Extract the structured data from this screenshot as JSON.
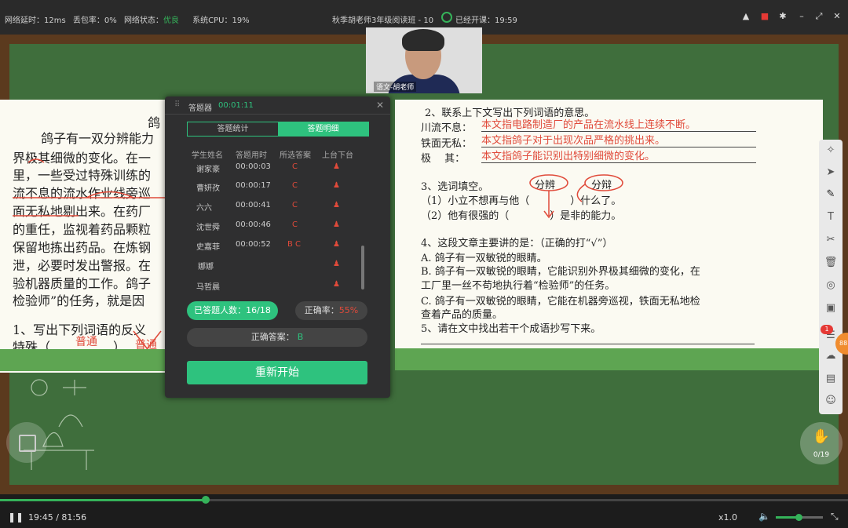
{
  "topbar": {
    "latency": "网络延时：12ms",
    "packet_loss": "丢包率：0%",
    "net_state_label": "网络状态：",
    "net_state_value": "优良",
    "cpu": "系统CPU：19%",
    "class_title": "秋季胡老师3年级阅读班 - 10",
    "elapsed": "已经开课：19:59"
  },
  "video": {
    "teacher_label": "语文-胡老师"
  },
  "left_page": {
    "heading": "鸽",
    "lines": [
      "鸽子有一双分辨能力",
      "界极其细微的变化。在一",
      "里，一些受过特殊训练的",
      "流不息的流水作业线旁巡",
      "面无私地剔出来。在药厂",
      "的重任，监视着药品颗粒",
      "保留地拣出药品。在炼钢",
      "泄，必要时发出警报。在",
      "验机器质量的工作。鸽子",
      "检验师”的任务，就是因"
    ],
    "q1": "1、写出下列词语的反义",
    "q1_line": "特殊（",
    "q1_close": "）",
    "q1_answer": "普通",
    "q1_crossed": "普通"
  },
  "quiz": {
    "title": "答题器",
    "timer": "00:01:11",
    "tabs": [
      "答题统计",
      "答题明细"
    ],
    "columns": [
      "学生姓名",
      "答题用时",
      "所选答案",
      "上台下台"
    ],
    "rows": [
      {
        "name": "谢家豪",
        "time": "00:00:03",
        "answer": "C"
      },
      {
        "name": "曹妍孜",
        "time": "00:00:17",
        "answer": "C"
      },
      {
        "name": "六六",
        "time": "00:00:41",
        "answer": "C"
      },
      {
        "name": "沈世舜",
        "time": "00:00:46",
        "answer": "C"
      },
      {
        "name": "史嘉菲",
        "time": "00:00:52",
        "answer": "B C"
      },
      {
        "name": "娜娜",
        "time": "",
        "answer": ""
      },
      {
        "name": "马哲晨",
        "time": "",
        "answer": ""
      }
    ],
    "answered": "已答题人数：16/18",
    "accuracy_label": "正确率：",
    "accuracy_value": "55%",
    "correct_label": "正确答案：",
    "correct_value": "B",
    "restart": "重新开始",
    "colors": {
      "accent": "#2ec27e",
      "wrong": "#e04a3a"
    }
  },
  "right_page": {
    "q2": "2、联系上下文写出下列词语的意思。",
    "q2_items": [
      {
        "term": "川流不息：",
        "answer": "本文指电路制造厂的产品在流水线上连续不断。"
      },
      {
        "term": "铁面无私：",
        "answer": "本文指鸽子对于出现次品严格的挑出来。"
      },
      {
        "term": "极　 其：",
        "answer": "本文指鸽子能识别出特别细微的变化。"
      }
    ],
    "q3": "3、选词填空。",
    "q3_words": [
      "分辨",
      "分辩"
    ],
    "q3_1": "（1）小立不想再与他（　　　　）什么了。",
    "q3_2": "（2）他有很强的（　　　　）是非的能力。",
    "q4": "4、这段文章主要讲的是：（正确的打“√”）",
    "q4_a": "A. 鸽子有一双敏锐的眼睛。",
    "q4_b1": "B. 鸽子有一双敏锐的眼睛，它能识别外界极其细微的变化，在",
    "q4_b2": "工厂里一丝不苟地执行着“检验师”的任务。",
    "q4_c1": "C. 鸽子有一双敏锐的眼睛，它能在机器旁巡视，铁面无私地检",
    "q4_c2": "查着产品的质量。",
    "q5": "5、请在文中找出若干个成语抄写下来。"
  },
  "tools": {
    "badge": "1",
    "orange_count": "88",
    "hand_count": "0/19"
  },
  "player": {
    "time": "19:45 / 81:56",
    "speed": "x1.0",
    "progress": 0.243,
    "volume": 0.5
  }
}
